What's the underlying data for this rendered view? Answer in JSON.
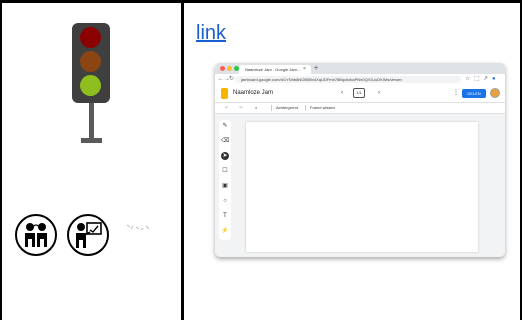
{
  "right": {
    "link_text": "link"
  },
  "screenshot": {
    "tab_title": "Naamloze Jam - Google Jam...",
    "tab_close": "×",
    "new_tab": "+",
    "url": "jamboard.google.com/d/1YNhb8NOB0Bx4XqUDFmb78Bqc6xkaPNn0Q/GLiuDKIMs/viewer",
    "doc_title": "Naamloze Jam",
    "frame_counter": "1/1",
    "prev_arrow": "‹",
    "next_arrow": "›",
    "share_label": "DELEN",
    "more_menu": "⋮",
    "undo": "↶",
    "redo": "↷",
    "zoom_icon": "⌕",
    "toolbar_background": "Achtergrond",
    "toolbar_clear": "Frame wissen",
    "tools": [
      "✎",
      "⌫",
      "➤",
      "☐",
      "▣",
      "○",
      "T",
      "⚡"
    ]
  },
  "colors": {
    "lamp_red": "#8b0000",
    "lamp_amber": "#8b4513",
    "lamp_green": "#8fbf1f",
    "link": "#1a5fd1",
    "share_button": "#1a73e8"
  }
}
